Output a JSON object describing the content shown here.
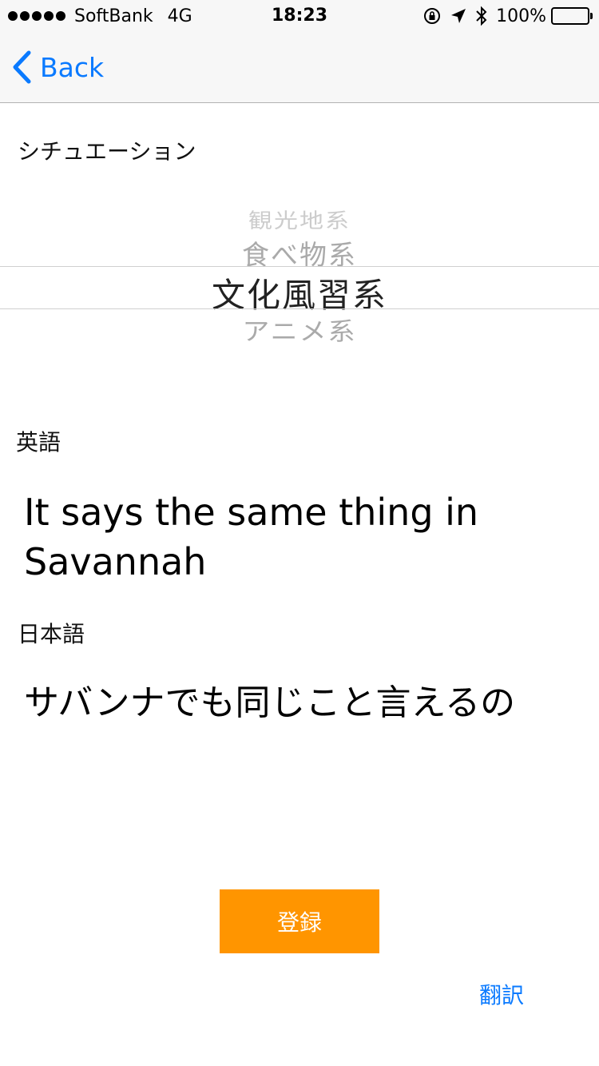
{
  "status_bar": {
    "carrier": "SoftBank",
    "network": "4G",
    "time": "18:23",
    "battery": "100%",
    "icons": [
      "rotation-lock-icon",
      "location-arrow-icon",
      "bluetooth-icon",
      "battery-icon"
    ]
  },
  "nav": {
    "back_label": "Back",
    "accent_color": "#0a7aff"
  },
  "situation": {
    "label": "シチュエーション",
    "picker_options": [
      "観光地系",
      "食べ物系",
      "文化風習系",
      "アニメ系"
    ],
    "selected": "文化風習系"
  },
  "english": {
    "label": "英語",
    "text": "It says the same thing in Savannah"
  },
  "japanese": {
    "label": "日本語",
    "text": "サバンナでも同じこと言えるの"
  },
  "actions": {
    "register_label": "登録",
    "register_color": "#ff9500",
    "translate_label": "翻訳"
  }
}
